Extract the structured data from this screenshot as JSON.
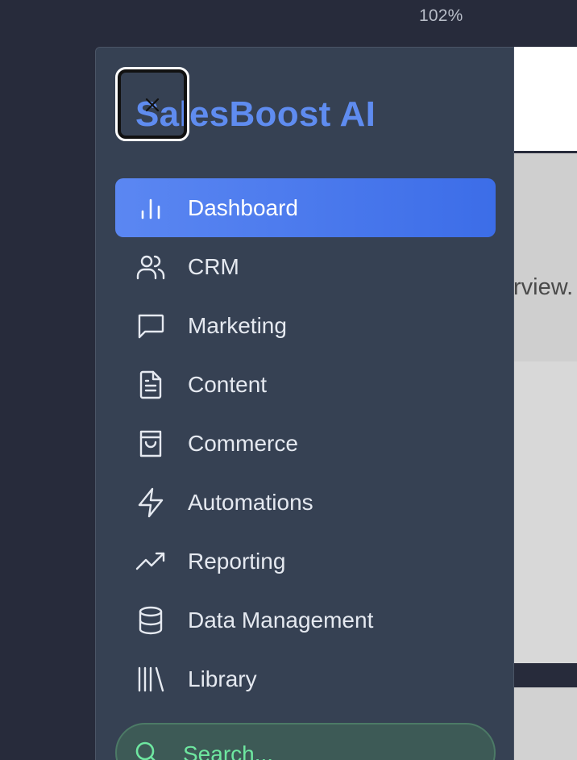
{
  "zoom": "102%",
  "background_page": {
    "partial_text": "rview."
  },
  "drawer": {
    "brand": "SalesBoost AI",
    "close_label": "Close menu",
    "nav_items": [
      {
        "label": "Dashboard",
        "icon": "bar-chart-icon",
        "active": true
      },
      {
        "label": "CRM",
        "icon": "users-icon",
        "active": false
      },
      {
        "label": "Marketing",
        "icon": "message-square-icon",
        "active": false
      },
      {
        "label": "Content",
        "icon": "file-text-icon",
        "active": false
      },
      {
        "label": "Commerce",
        "icon": "shopping-bag-icon",
        "active": false
      },
      {
        "label": "Automations",
        "icon": "zap-icon",
        "active": false
      },
      {
        "label": "Reporting",
        "icon": "trending-up-icon",
        "active": false
      },
      {
        "label": "Data Management",
        "icon": "database-icon",
        "active": false
      },
      {
        "label": "Library",
        "icon": "library-icon",
        "active": false
      }
    ],
    "search": {
      "placeholder": "Search..."
    }
  },
  "colors": {
    "accent": "#4f7cf0",
    "drawer_bg": "#364153",
    "search_text": "#6ee7a0"
  }
}
